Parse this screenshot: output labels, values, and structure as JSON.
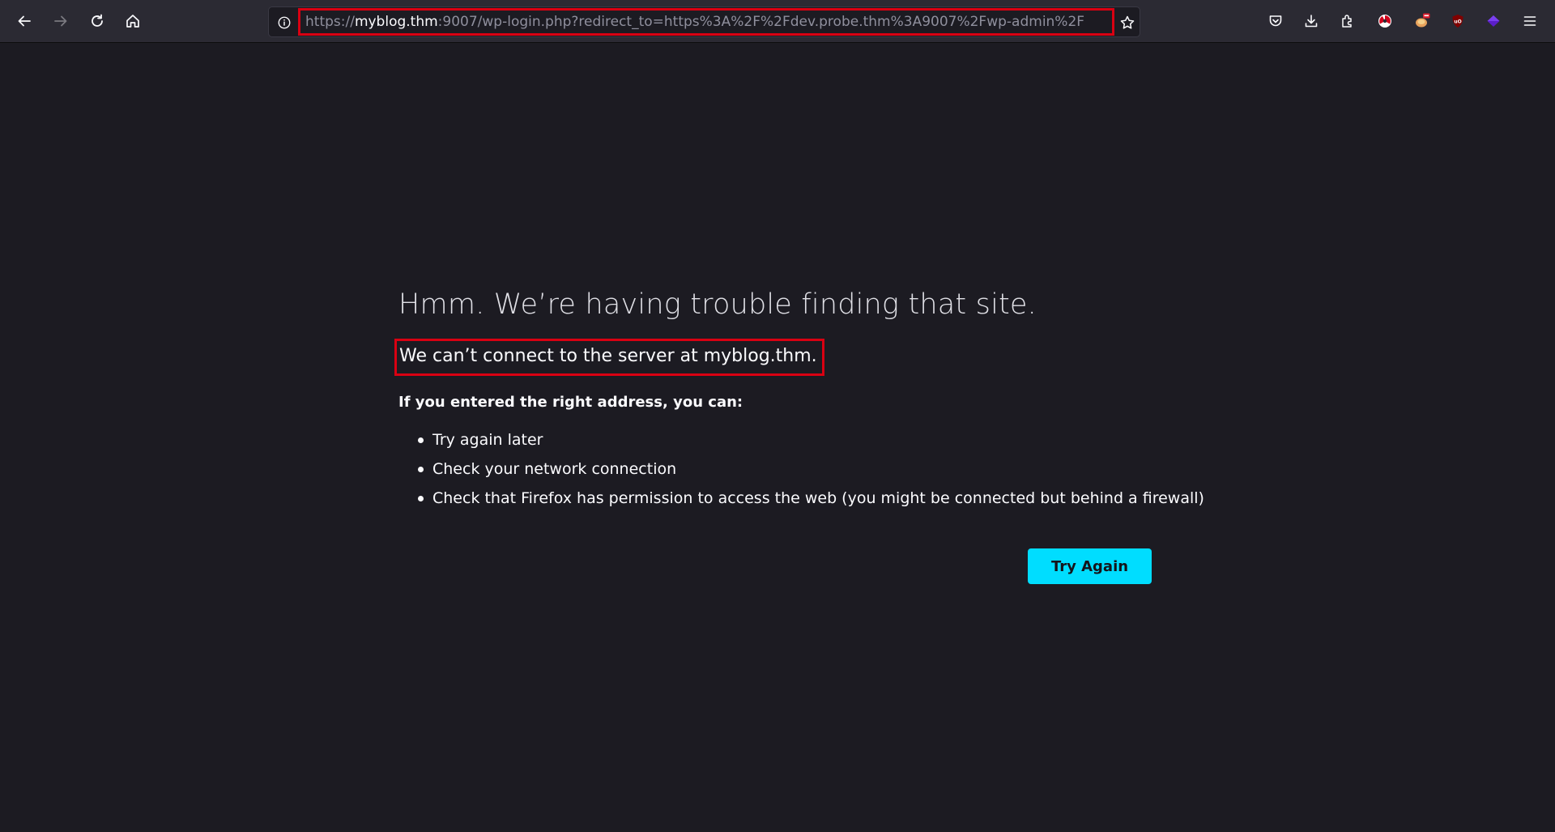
{
  "toolbar": {
    "back": "back-arrow-icon",
    "forward": "forward-arrow-icon",
    "reload": "reload-icon",
    "home": "home-icon",
    "url_scheme": "https://",
    "url_host": "myblog.thm",
    "url_rest": ":9007/wp-login.php?redirect_to=https%3A%2F%2Fdev.probe.thm%3A9007%2Fwp-admin%2F",
    "right_icons": [
      "pocket-icon",
      "downloads-icon",
      "extensions-icon",
      "extension-icon",
      "extension-icon",
      "ublock-origin-icon",
      "extension-icon",
      "menu-icon"
    ]
  },
  "error_page": {
    "title": "Hmm. We’re having trouble finding that site.",
    "subtitle": "We can’t connect to the server at myblog.thm.",
    "lead": "If you entered the right address, you can:",
    "tips": [
      "Try again later",
      "Check your network connection",
      "Check that Firefox has permission to access the web (you might be connected but behind a firewall)"
    ],
    "try_again_label": "Try Again"
  },
  "colors": {
    "page_bg": "#1c1b22",
    "toolbar_bg": "#2b2a33",
    "highlight_box": "#d90012",
    "primary_button": "#00ddff"
  }
}
